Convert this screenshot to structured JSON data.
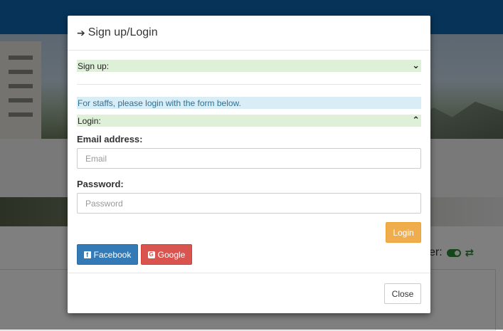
{
  "background": {
    "status_label": "er:",
    "toggle_icon": "toggle-on-icon",
    "refresh_icon": "retweet-icon"
  },
  "modal": {
    "title": "Sign up/Login",
    "title_icon": "sign-in-icon",
    "signup_header": "Sign up:",
    "signup_chevron": "chevron-down-icon",
    "staff_notice": "For staffs, please login with the form below.",
    "login_header": "Login:",
    "login_chevron": "chevron-up-icon",
    "email_label": "Email address:",
    "email_placeholder": "Email",
    "email_value": "",
    "password_label": "Password:",
    "password_placeholder": "Password",
    "password_value": "",
    "login_button": "Login",
    "facebook_button": "Facebook",
    "google_button": "Google",
    "close_button": "Close"
  },
  "colors": {
    "header_blue": "#0f66b3",
    "success_bar": "#dff0d8",
    "info_bar": "#d9edf7",
    "login_btn": "#f0ad4e",
    "facebook_btn": "#337ab7",
    "google_btn": "#d9534f"
  }
}
